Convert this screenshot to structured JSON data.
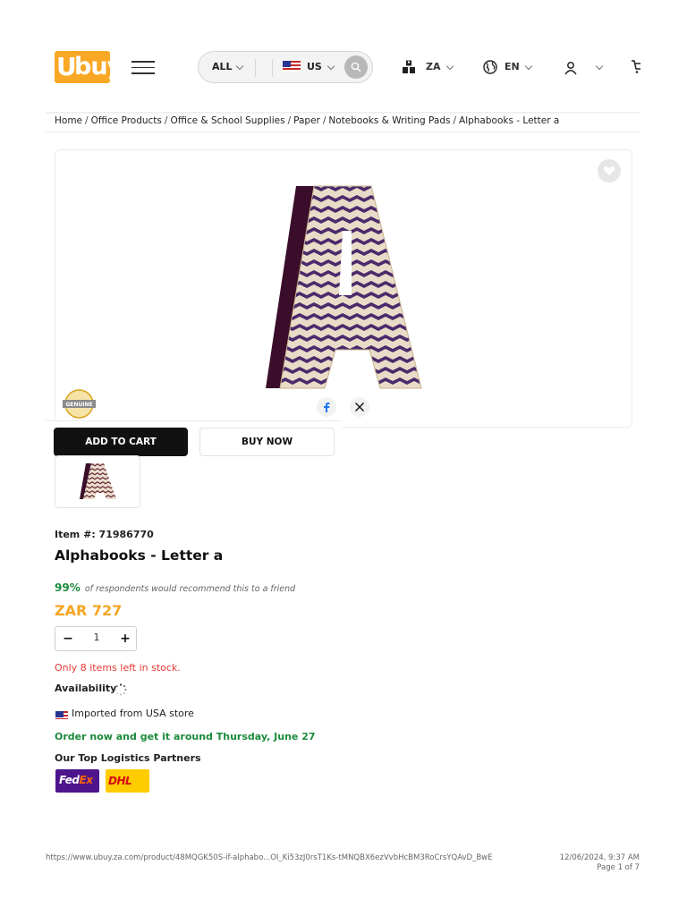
{
  "header": {
    "logo_u": "U",
    "logo_buy": "buy",
    "search_category": "ALL",
    "store_country": "US",
    "ship_to": "ZA",
    "language": "EN"
  },
  "breadcrumb": [
    "Home",
    "Office Products",
    "Office & School Supplies",
    "Paper",
    "Notebooks & Writing Pads",
    "Alphabooks - Letter a"
  ],
  "breadcrumb_separator": "/",
  "actions": {
    "add_to_cart": "ADD TO CART",
    "buy_now": "BUY NOW"
  },
  "product": {
    "item_number": "Item #: 71986770",
    "title": "Alphabooks - Letter a",
    "recommend_pct": "99%",
    "recommend_text": "of respondents would recommend this to a friend",
    "price": "ZAR 727",
    "quantity": "1",
    "stock_note": "Only 8 items left in stock.",
    "availability_label": "Availability",
    "imported_from": "Imported from USA store",
    "delivery_estimate": "Order now and get it around Thursday, June 27",
    "logistics_heading": "Our Top Logistics Partners",
    "logistics_partners": [
      "FedEx",
      "DHL"
    ]
  },
  "badge_text": "GENUINE",
  "footer": {
    "url": "https://www.ubuy.za.com/product/48MQGK50S-if-alphabo...OI_Ki53zJ0rsT1Ks-tMNQBX6ezVvbHcBM3RoCrsYQAvD_BwE",
    "datetime": "12/06/2024, 9:37 AM",
    "page": "Page 1 of 7"
  },
  "colors": {
    "brand_orange": "#f9a825",
    "price": "#f5a623",
    "success_green": "#1b8a3a",
    "stock_red": "#e53935",
    "letter_purple": "#4b2a6b"
  }
}
